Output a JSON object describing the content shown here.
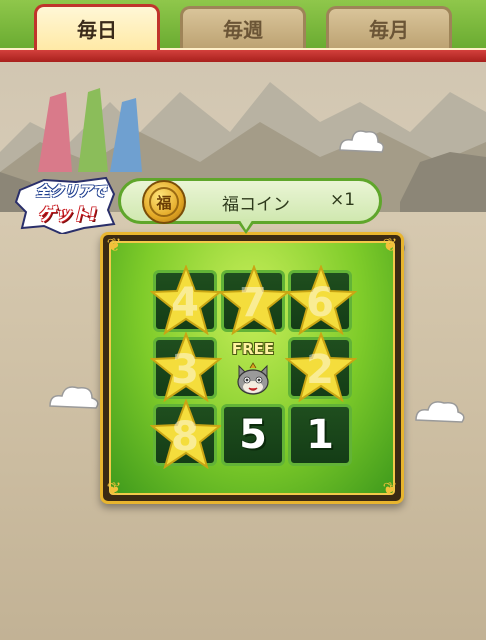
{
  "tabs": [
    {
      "label": "毎日",
      "active": true
    },
    {
      "label": "毎週",
      "active": false
    },
    {
      "label": "毎月",
      "active": false
    }
  ],
  "banner": {
    "badge_line1": "全クリアで",
    "badge_line2": "ゲット!",
    "reward_name": "福コイン",
    "reward_quantity": "×1",
    "coin_glyph": "福"
  },
  "board": {
    "free_label": "FREE",
    "grid": [
      {
        "label": "4",
        "completed": true
      },
      {
        "label": "7",
        "completed": true
      },
      {
        "label": "6",
        "completed": true
      },
      {
        "label": "3",
        "completed": true
      },
      {
        "label": "FREE",
        "completed": true
      },
      {
        "label": "2",
        "completed": true
      },
      {
        "label": "8",
        "completed": true
      },
      {
        "label": "5",
        "completed": false
      },
      {
        "label": "1",
        "completed": false
      }
    ]
  },
  "colors": {
    "tab_active_border": "#c0342c",
    "board_green": "#7fcc2a",
    "star_yellow": "#f4dd3c"
  }
}
